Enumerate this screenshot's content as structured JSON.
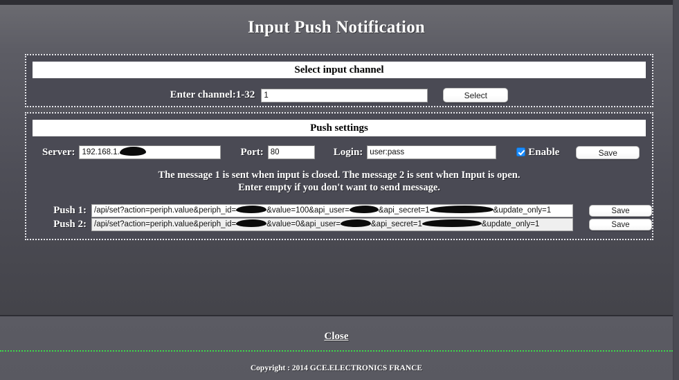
{
  "page": {
    "title": "Input Push Notification"
  },
  "channel_panel": {
    "header": "Select input channel",
    "label": "Enter channel:1-32",
    "input_value": "1",
    "select_button": "Select"
  },
  "push_panel": {
    "header": "Push settings",
    "server_label": "Server:",
    "server_value": "192.168.1.",
    "port_label": "Port:",
    "port_value": "80",
    "login_label": "Login:",
    "login_value": "user:pass",
    "enable_label": "Enable",
    "enable_checked": true,
    "save_button": "Save",
    "message_line1": "The message 1 is sent when input is closed. The message 2 is sent when Input is open.",
    "message_line2": "Enter empty if you don't want to send message.",
    "push_rows": [
      {
        "label": "Push 1:",
        "url_part1": "/api/set?action=periph.value&periph_id=",
        "url_part2": "&value=100&api_user=",
        "url_part3": "&api_secret=1",
        "url_part4": "&update_only=1",
        "save_button": "Save"
      },
      {
        "label": "Push 2:",
        "url_part1": "/api/set?action=periph.value&periph_id=",
        "url_part2": "&value=0&api_user=",
        "url_part3": "&api_secret=1",
        "url_part4": "&update_only=1",
        "save_button": "Save"
      }
    ]
  },
  "footer": {
    "close_label": "Close",
    "copyright": "Copyright : 2014 GCE.ELECTRONICS FRANCE",
    "divider_color": "#3cd94a"
  }
}
